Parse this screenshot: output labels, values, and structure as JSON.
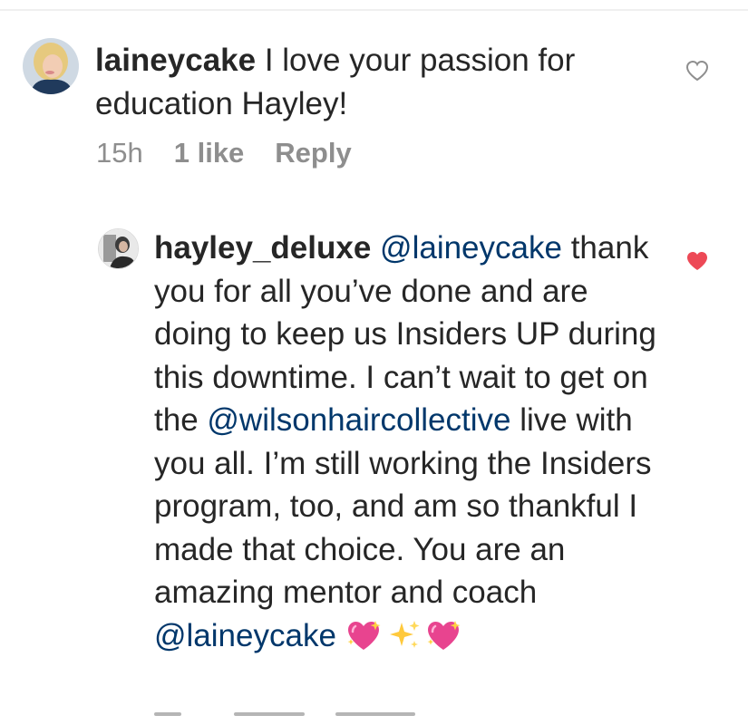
{
  "comment1": {
    "username": "laineycake",
    "text": "I love your passion for education Hayley!",
    "timestamp": "15h",
    "likes": "1 like",
    "reply_label": "Reply",
    "heart_icon": "heart-outline-icon",
    "liked": false
  },
  "reply1": {
    "username": "hayley_deluxe",
    "mention_start": "@laineycake",
    "text_part1": "thank you for all you’ve done and are doing to keep us Insiders UP during this downtime. I can’t wait to get on the",
    "mention_mid": "@wilsonhaircollective",
    "text_part2": "live with you all. I’m still working the Insiders program, too, and am so thankful I made that choice. You are an amazing mentor and coach",
    "mention_end": "@laineycake",
    "emojis": [
      "sparkling-heart-icon",
      "sparkles-icon",
      "sparkling-heart-icon"
    ],
    "heart_icon": "heart-filled-icon",
    "liked": true
  },
  "colors": {
    "text": "#262626",
    "meta": "#8e8e8e",
    "mention": "#00376b",
    "liked_heart": "#ed4956"
  }
}
